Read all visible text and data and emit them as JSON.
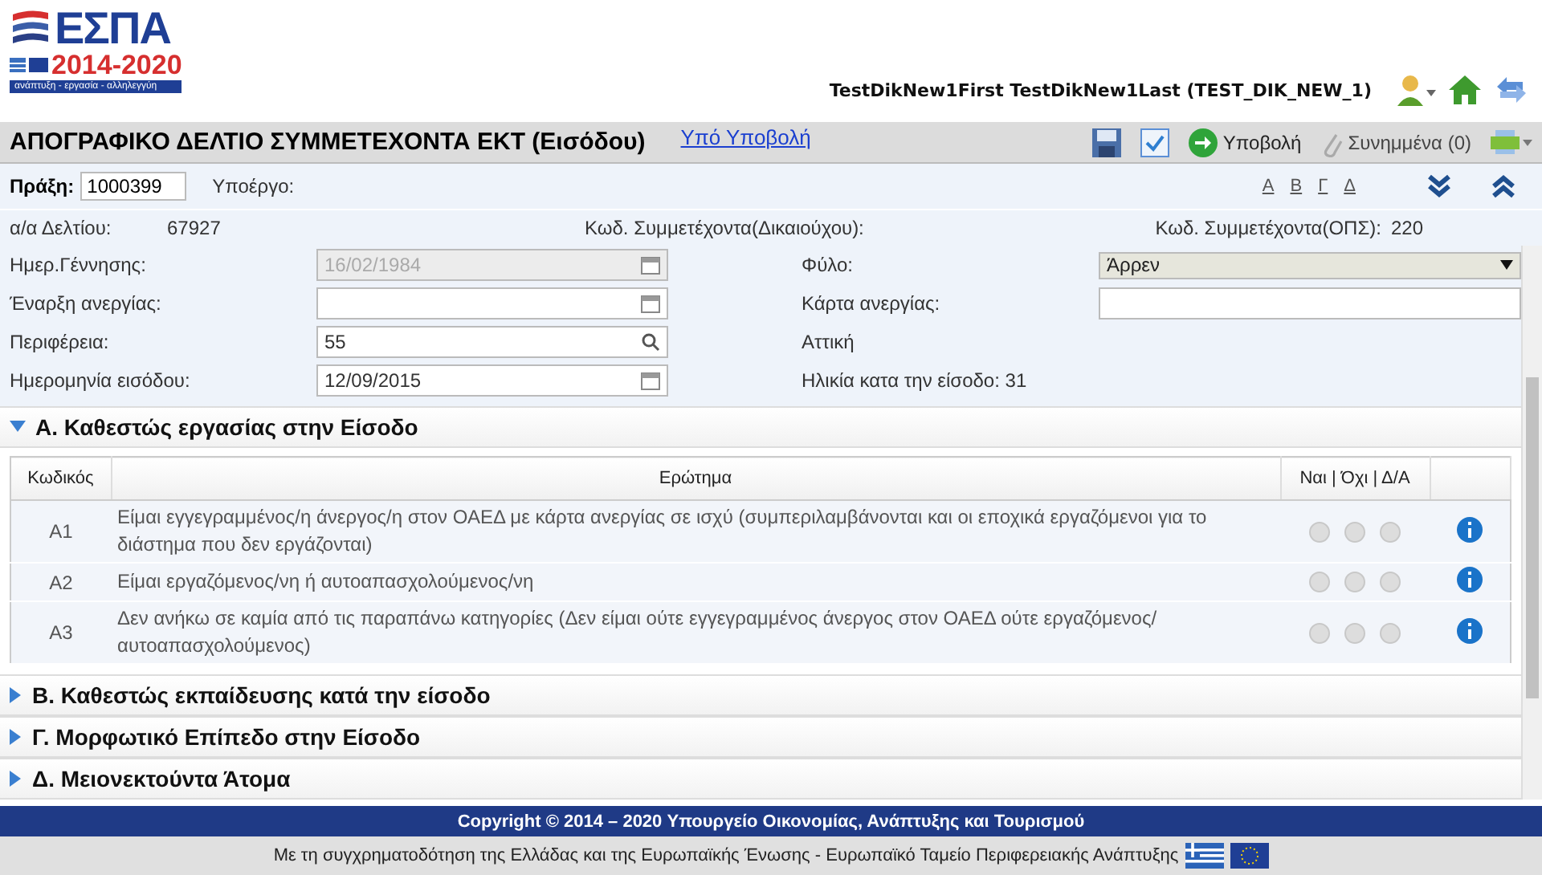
{
  "logo": {
    "title": "ΕΣΠΑ",
    "years": "2014-2020",
    "tagline": "ανάπτυξη - εργασία - αλληλεγγύη"
  },
  "user": {
    "name": "TestDikNew1First TestDikNew1Last (TEST_DIK_NEW_1)"
  },
  "title_bar": {
    "title": "ΑΠΟΓΡΑΦΙΚΟ ΔΕΛΤΙΟ ΣΥΜΜΕΤΕΧΟΝΤΑ ΕΚΤ (Εισόδου)",
    "status_link": "Υπό Υποβολή",
    "submit": "Υποβολή",
    "attachments": "Συνημμένα (0)"
  },
  "praxi": {
    "label": "Πράξη:",
    "value": "1000399",
    "subproject_label": "Υποέργο:",
    "letters": [
      "Α",
      "Β",
      "Γ",
      "Δ"
    ]
  },
  "info": {
    "ada_label": "α/α Δελτίου:",
    "ada_value": "67927",
    "code_label": "Κωδ. Συμμετέχοντα(Δικαιούχου):",
    "ops_label": "Κωδ. Συμμετέχοντα(ΟΠΣ):",
    "ops_value": "220"
  },
  "form": {
    "fields": [
      {
        "kind": "date",
        "label": "Ημερ.Γέννησης:",
        "value": "16/02/1984",
        "disabled": true
      },
      {
        "kind": "select",
        "label": "Φύλο:",
        "value": "Άρρεν",
        "disabled": false
      },
      {
        "kind": "date",
        "label": "Έναρξη ανεργίας:",
        "disabled": false
      },
      {
        "kind": "text",
        "label": "Κάρτα ανεργίας:",
        "disabled": false
      },
      {
        "kind": "search",
        "label": "Περιφέρεια:",
        "value": "55",
        "disabled": false
      },
      {
        "kind": "static",
        "label": "Αττική"
      },
      {
        "kind": "date",
        "label": "Ημερομηνία εισόδου:",
        "value": "12/09/2015",
        "disabled": false
      },
      {
        "kind": "static",
        "label": "Ηλικία κατα την είσοδο: 31"
      }
    ]
  },
  "sections": [
    {
      "title": "Α. Καθεστώς εργασίας στην Είσοδο",
      "expanded": true,
      "table": {
        "columns": [
          "Κωδικός",
          "Ερώτημα",
          "Ναι | Όχι | Δ/Α"
        ],
        "rows": [
          {
            "code": "Α1",
            "question": "Είμαι εγγεγραμμένος/η άνεργος/η στον ΟΑΕΔ με κάρτα ανεργίας σε ισχύ (συμπεριλαμβάνονται και οι εποχικά εργαζόμενοι για το διάστημα που δεν εργάζονται)",
            "choices": [
              {
                "selected": false
              },
              {
                "selected": false
              },
              {
                "selected": false
              }
            ]
          },
          {
            "code": "Α2",
            "question": "Είμαι εργαζόμενος/νη ή αυτοαπασχολούμενος/νη",
            "choices": [
              {
                "selected": false
              },
              {
                "selected": false
              },
              {
                "selected": false
              }
            ]
          },
          {
            "code": "Α3",
            "question": "Δεν ανήκω σε καμία από τις παραπάνω κατηγορίες (Δεν είμαι ούτε εγγεγραμμένος άνεργος στον ΟΑΕΔ ούτε εργαζόμενος/ αυτοαπασχολούμενος)",
            "choices": [
              {
                "selected": false
              },
              {
                "selected": false
              },
              {
                "selected": false
              }
            ]
          }
        ]
      }
    },
    {
      "title": "Β. Καθεστώς εκπαίδευσης κατά την είσοδο",
      "expanded": false
    },
    {
      "title": "Γ. Μορφωτικό Επίπεδο στην Είσοδο",
      "expanded": false
    },
    {
      "title": "Δ. Μειονεκτούντα Άτομα",
      "expanded": false
    }
  ],
  "footer": {
    "copyright": "Copyright © 2014 – 2020 Υπουργείο Οικονομίας, Ανάπτυξης και Τουρισμού",
    "funding": "Με τη συγχρηματοδότηση της Ελλάδας και της Ευρωπαϊκής Ένωσης - Ευρωπαϊκό Ταμείο Περιφερειακής Ανάπτυξης"
  }
}
